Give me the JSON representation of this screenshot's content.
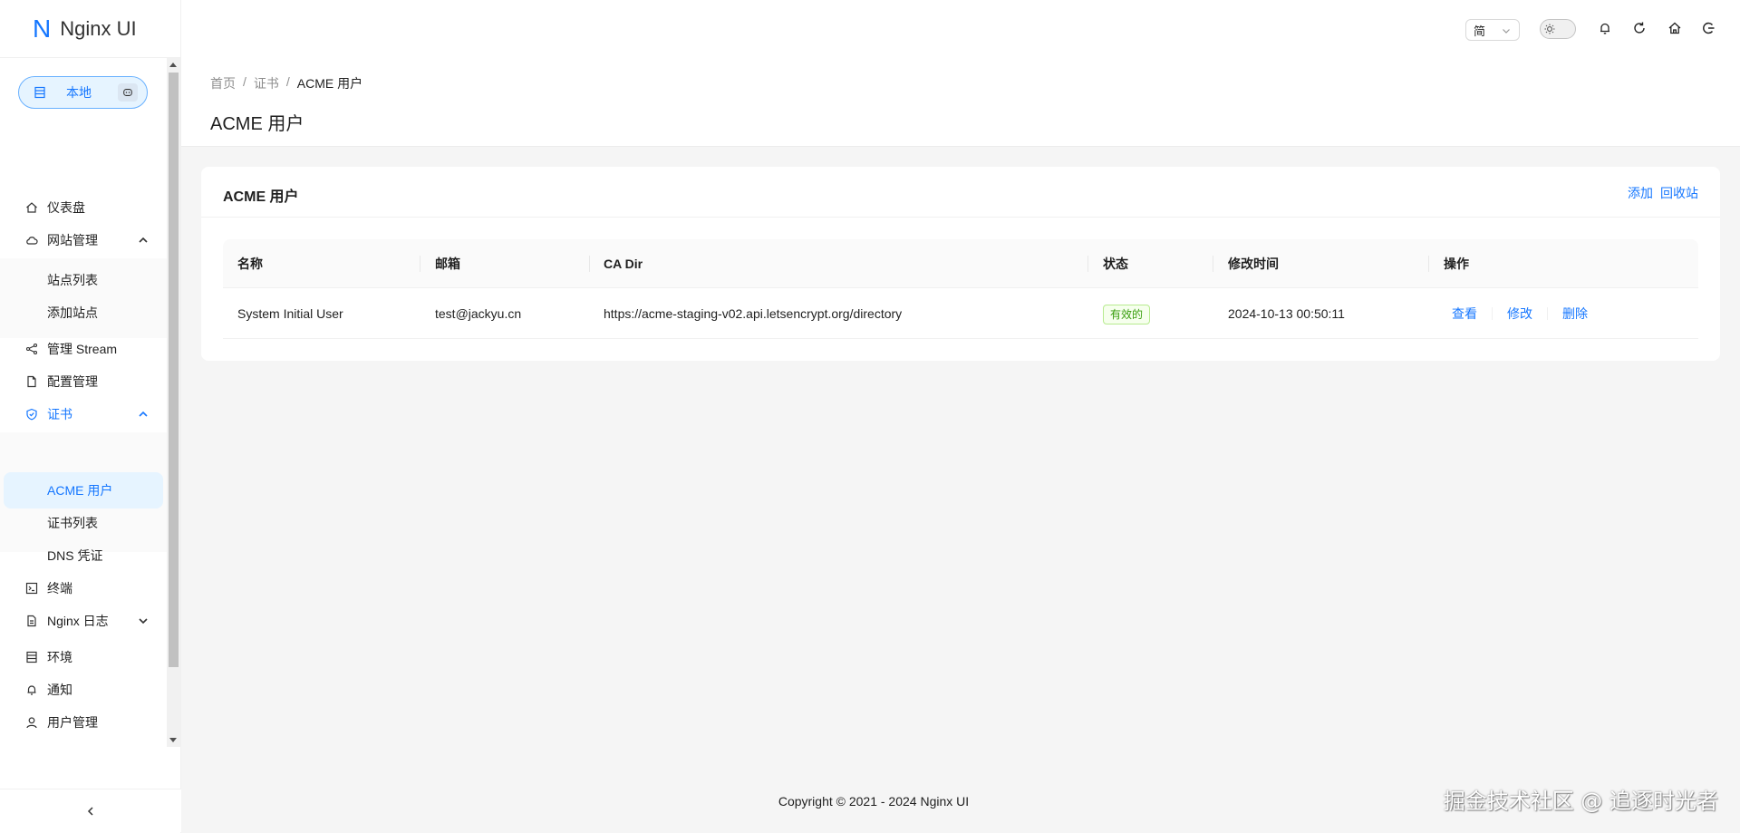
{
  "brand": {
    "mark": "N",
    "name": "Nginx UI"
  },
  "env": {
    "label": "本地"
  },
  "menu": {
    "dashboard": "仪表盘",
    "sites": "网站管理",
    "site_list": "站点列表",
    "add_site": "添加站点",
    "stream": "管理 Stream",
    "config": "配置管理",
    "cert": "证书",
    "acme_users": "ACME 用户",
    "cert_list": "证书列表",
    "dns_cred": "DNS 凭证",
    "terminal": "终端",
    "nginx_log": "Nginx 日志",
    "environment": "环境",
    "notification": "通知",
    "user_mgmt": "用户管理"
  },
  "header": {
    "lang": "简"
  },
  "breadcrumb": {
    "home": "首页",
    "cert": "证书",
    "current": "ACME 用户"
  },
  "page": {
    "title": "ACME 用户"
  },
  "card": {
    "title": "ACME 用户",
    "add": "添加",
    "trash": "回收站"
  },
  "table": {
    "columns": {
      "name": "名称",
      "email": "邮箱",
      "ca_dir": "CA Dir",
      "status": "状态",
      "updated": "修改时间",
      "actions": "操作"
    },
    "rows": [
      {
        "name": "System Initial User",
        "email": "test@jackyu.cn",
        "ca_dir": "https://acme-staging-v02.api.letsencrypt.org/directory",
        "status": "有效的",
        "updated": "2024-10-13 00:50:11",
        "view": "查看",
        "edit": "修改",
        "delete": "删除"
      }
    ]
  },
  "footer": {
    "copyright": "Copyright © 2021 - 2024 Nginx UI"
  },
  "watermark": "掘金技术社区 @ 追逐时光者",
  "colors": {
    "primary": "#1677ff",
    "success": "#389e0d"
  }
}
